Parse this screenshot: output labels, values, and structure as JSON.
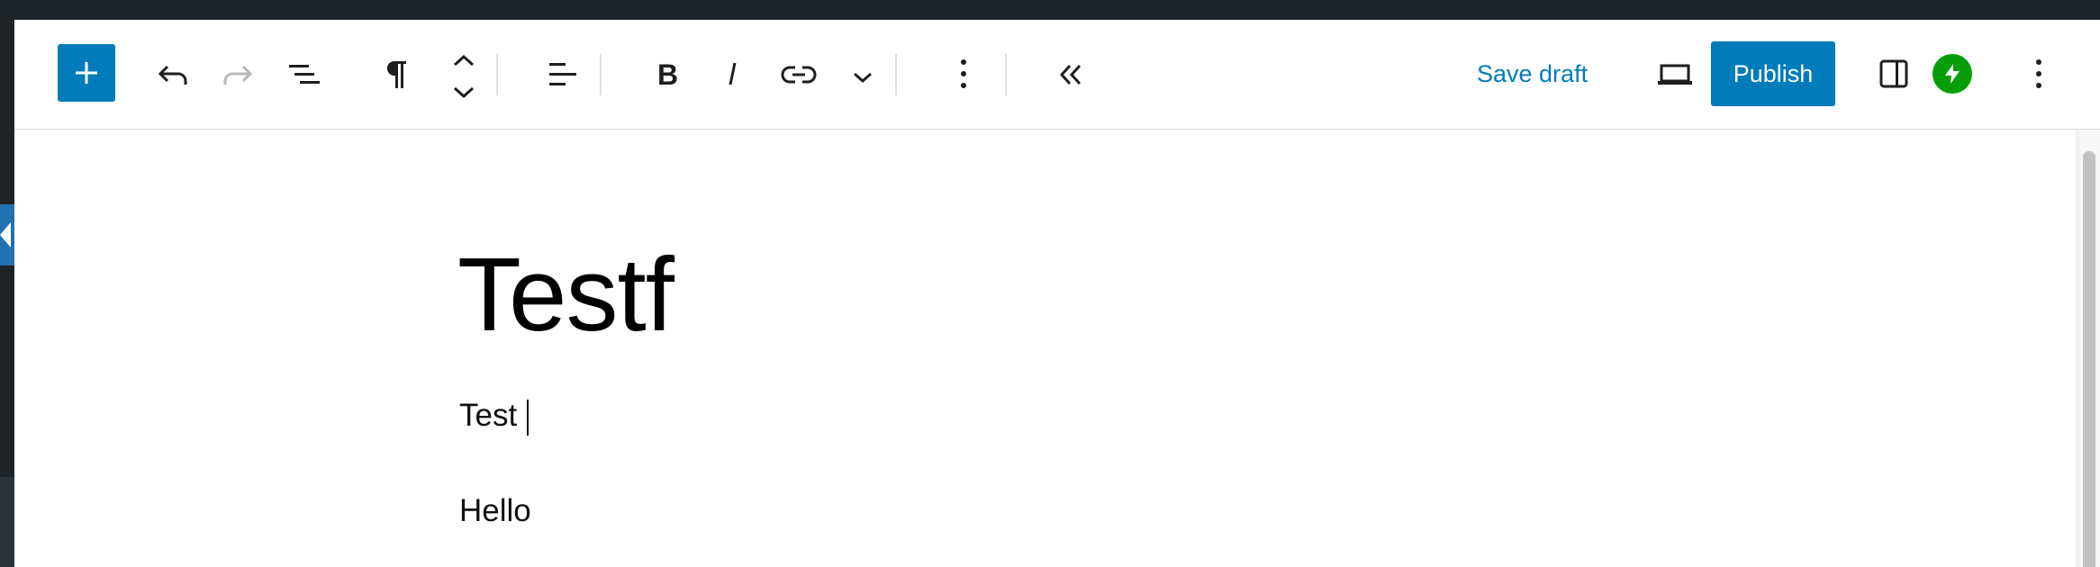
{
  "toolbar": {
    "save_draft_label": "Save draft",
    "publish_label": "Publish"
  },
  "post": {
    "title": "Testf",
    "paragraphs": [
      "Test",
      "Hello"
    ]
  },
  "colors": {
    "accent": "#007cba",
    "admin_dark": "#1d2327",
    "jetpack_green": "#069e08"
  },
  "icons": [
    "add-block-icon",
    "undo-icon",
    "redo-icon",
    "document-overview-icon",
    "paragraph-icon",
    "move-up-down-icon",
    "align-left-icon",
    "bold-icon",
    "italic-icon",
    "link-icon",
    "chevron-down-icon",
    "block-options-icon",
    "collapse-toolbar-icon",
    "desktop-preview-icon",
    "settings-sidebar-icon",
    "jetpack-icon",
    "options-icon"
  ]
}
